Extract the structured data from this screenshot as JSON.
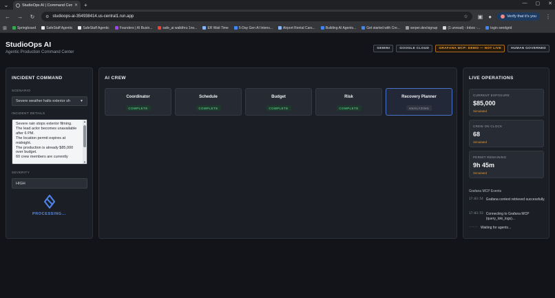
{
  "browser": {
    "tab_title": "StudioOps AI | Command Cente",
    "url": "studioops-ai-354938414.us-central1.run.app",
    "verify_label": "Verify that it's you",
    "bookmarks": [
      "Springboard",
      "SafeStaff Agentic",
      "SafeStaff Agentic",
      "Founders | AI Busin...",
      "safe_ai walkthru 1no...",
      "ER Wait Time",
      "5-Day Gen AI Intens...",
      "Airport Rental Cars...",
      "Building AI Agents...",
      "Get started with Cre...",
      "serper.dev/signup",
      "(1 unread) - Inbox -...",
      "login sendgrid"
    ]
  },
  "header": {
    "title": "StudioOps AI",
    "subtitle": "Agentic Production Command Center",
    "badges": [
      "GEMINI",
      "GOOGLE CLOUD",
      "GRAFANA MCP: DEMO — NOT LIVE",
      "HUMAN GOVERNED"
    ]
  },
  "incident": {
    "title": "INCIDENT COMMAND",
    "scenario_label": "SCENARIO",
    "scenario_value": "Severe weather halts exterior sh",
    "details_label": "INCIDENT DETAILS",
    "details_text": "Severe rain stops exterior filming.\nThe lead actor becomes unavailable after 6 PM.\nThe location permit expires at midnight.\nThe production is already $85,000 over budget.\n60 crew members are currently",
    "severity_label": "SEVERITY",
    "severity_value": "HIGH",
    "processing_label": "PROCESSING..."
  },
  "crew": {
    "title": "AI CREW",
    "agents": [
      {
        "name": "Coordinator",
        "status": "COMPLETE"
      },
      {
        "name": "Schedule",
        "status": "COMPLETE"
      },
      {
        "name": "Budget",
        "status": "COMPLETE"
      },
      {
        "name": "Risk",
        "status": "COMPLETE"
      },
      {
        "name": "Recovery Planner",
        "status": "ANALYZING"
      }
    ]
  },
  "live": {
    "title": "LIVE OPERATIONS",
    "stats": [
      {
        "label": "CURRENT EXPOSURE",
        "value": "$85,000",
        "tag": "Simulated"
      },
      {
        "label": "CREW ON CLOCK",
        "value": "68",
        "tag": "Simulated"
      },
      {
        "label": "PERMIT REMAINING",
        "value": "9h 45m",
        "tag": "Simulated"
      }
    ],
    "events_title": "Grafana MCP Events",
    "events": [
      {
        "time": "17:03:54",
        "text": "Grafana context retrieved successfully."
      },
      {
        "time": "17:03:53",
        "text": "Connecting to Grafana MCP (query_loki_logs)..."
      },
      {
        "time": "-----",
        "text": "Waiting for agents..."
      }
    ]
  },
  "colors": {
    "accent": "#4a72c8",
    "complete": "#57b27c",
    "warning": "#f2a13a"
  }
}
